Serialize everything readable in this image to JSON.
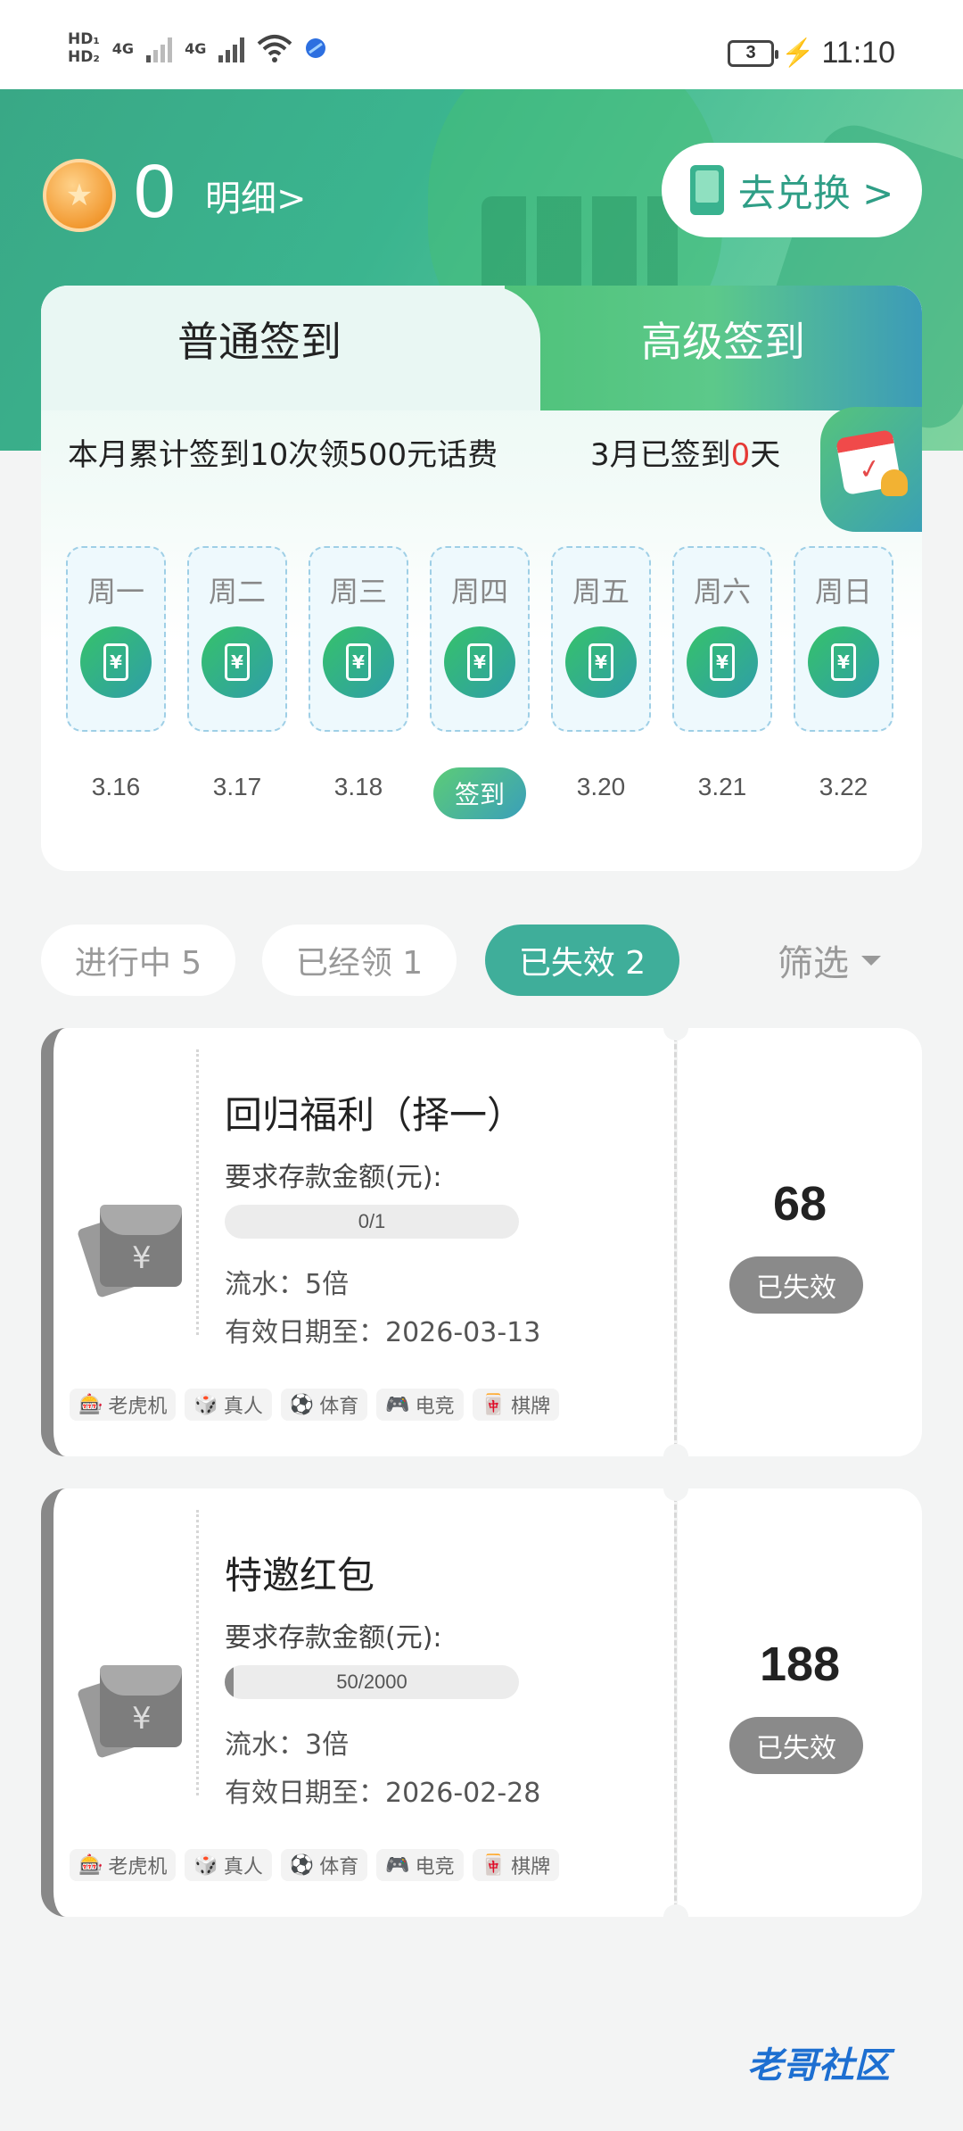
{
  "status_bar": {
    "hd1": "HD₁",
    "hd2": "HD₂",
    "net1": "4G",
    "net2": "4G",
    "battery": "3",
    "time": "11:10"
  },
  "header": {
    "coin_count": "0",
    "detail_link": "明细>",
    "exchange_button": "去兑换 >"
  },
  "signin": {
    "tab_normal": "普通签到",
    "tab_advanced": "高级签到",
    "promo": "本月累计签到10次领500元话费",
    "signed_prefix": "3月已签到",
    "signed_count": "0",
    "signed_suffix": "天",
    "reward_glyph": "¥",
    "days": [
      {
        "name": "周一",
        "date": "3.16"
      },
      {
        "name": "周二",
        "date": "3.17"
      },
      {
        "name": "周三",
        "date": "3.18"
      },
      {
        "name": "周四",
        "date": "签到"
      },
      {
        "name": "周五",
        "date": "3.20"
      },
      {
        "name": "周六",
        "date": "3.21"
      },
      {
        "name": "周日",
        "date": "3.22"
      }
    ]
  },
  "filters": {
    "tabs": [
      {
        "label": "进行中  5"
      },
      {
        "label": "已经领  1"
      },
      {
        "label": "已失效  2"
      }
    ],
    "active_tab": 2,
    "filter_label": "筛选"
  },
  "coupons": [
    {
      "title": "回归福利（择一）",
      "requirement_label": "要求存款金额(元):",
      "progress_text": "0/1",
      "progress_fraction": 0.0,
      "turnover": "流水：5倍",
      "expiry": "有效日期至：2026-03-13",
      "amount": "68",
      "status": "已失效",
      "tags": [
        "老虎机",
        "真人",
        "体育",
        "电竞",
        "棋牌"
      ]
    },
    {
      "title": "特邀红包",
      "requirement_label": "要求存款金额(元):",
      "progress_text": "50/2000",
      "progress_fraction": 0.025,
      "turnover": "流水：3倍",
      "expiry": "有效日期至：2026-02-28",
      "amount": "188",
      "status": "已失效",
      "tags": [
        "老虎机",
        "真人",
        "体育",
        "电竞",
        "棋牌"
      ]
    }
  ],
  "tag_icons": [
    "slot-machine-icon",
    "dice-icon",
    "soccer-ball-icon",
    "gamepad-icon",
    "mahjong-tile-icon"
  ],
  "tag_glyphs": [
    "🎰",
    "🎲",
    "⚽",
    "🎮",
    "🀄"
  ],
  "watermark": "老哥社区",
  "colors": {
    "accent": "#3fae9a",
    "expired": "#8a8a8a",
    "alert": "#e53935"
  }
}
